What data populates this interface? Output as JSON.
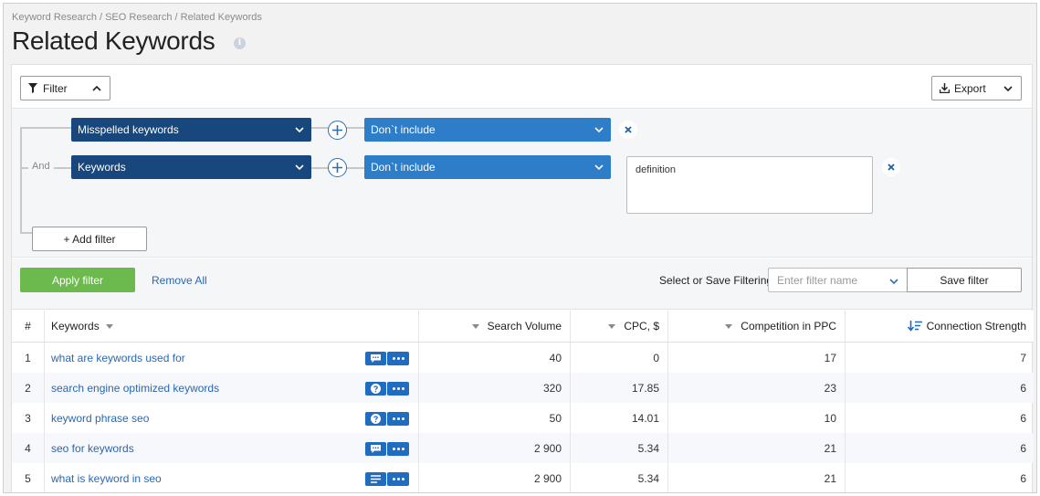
{
  "breadcrumb": "Keyword Research / SEO Research / Related Keywords",
  "page_title": "Related Keywords",
  "toolbar": {
    "filter_label": "Filter",
    "export_label": "Export"
  },
  "filters": {
    "and_label": "And",
    "rows": [
      {
        "field": "Misspelled keywords",
        "condition": "Don`t include",
        "value": ""
      },
      {
        "field": "Keywords",
        "condition": "Don`t include",
        "value": "definition"
      }
    ],
    "add_filter_label": "+ Add filter"
  },
  "actions": {
    "apply_label": "Apply filter",
    "remove_all_label": "Remove All",
    "save_label": "Select or Save Filtering:",
    "filter_name_placeholder": "Enter filter name",
    "save_button_label": "Save filter"
  },
  "table": {
    "columns": {
      "num": "#",
      "keywords": "Keywords",
      "search_volume": "Search Volume",
      "cpc": "CPC, $",
      "competition": "Competition in PPC",
      "connection": "Connection Strength"
    },
    "rows": [
      {
        "num": "1",
        "keyword": "what are keywords used for",
        "icon": "comment-icon",
        "search_volume": "40",
        "cpc": "0",
        "competition": "17",
        "connection": "7"
      },
      {
        "num": "2",
        "keyword": "search engine optimized keywords",
        "icon": "question-icon",
        "search_volume": "320",
        "cpc": "17.85",
        "competition": "23",
        "connection": "6"
      },
      {
        "num": "3",
        "keyword": "keyword phrase seo",
        "icon": "question-icon",
        "search_volume": "50",
        "cpc": "14.01",
        "competition": "10",
        "connection": "6"
      },
      {
        "num": "4",
        "keyword": "seo for keywords",
        "icon": "comment-icon",
        "search_volume": "2 900",
        "cpc": "5.34",
        "competition": "21",
        "connection": "6"
      },
      {
        "num": "5",
        "keyword": "what is keyword in seo",
        "icon": "text-lines-icon",
        "search_volume": "2 900",
        "cpc": "5.34",
        "competition": "21",
        "connection": "6"
      }
    ]
  },
  "colors": {
    "dark_select": "#17477c",
    "blue_select": "#2d7dc9",
    "apply_green": "#6cb94e",
    "link_blue": "#2b67b0"
  }
}
